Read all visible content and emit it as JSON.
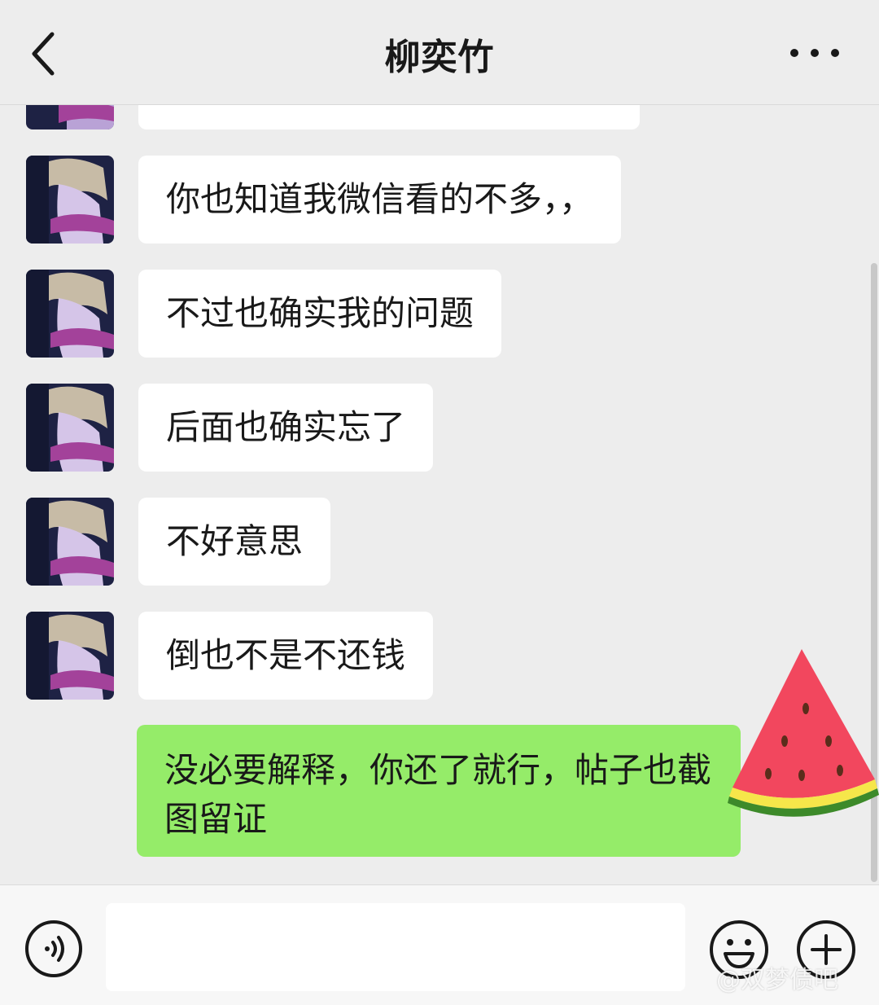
{
  "header": {
    "title": "柳奕竹"
  },
  "messages": [
    {
      "text": "你也知道我微信看的不多，，"
    },
    {
      "text": "不过也确实我的问题"
    },
    {
      "text": "后面也确实忘了"
    },
    {
      "text": "不好意思"
    },
    {
      "text": "倒也不是不还钱"
    }
  ],
  "my_message": {
    "text": "没必要解释，你还了就行，帖子也截图留证"
  },
  "watermark": "@双梦债吧",
  "colors": {
    "background": "#ededed",
    "my_bubble": "#95ec69",
    "their_bubble": "#ffffff"
  },
  "icons": {
    "back": "chevron-left",
    "more": "ellipsis",
    "voice": "voice-wave",
    "emoji": "smiley",
    "plus": "plus-circle"
  }
}
